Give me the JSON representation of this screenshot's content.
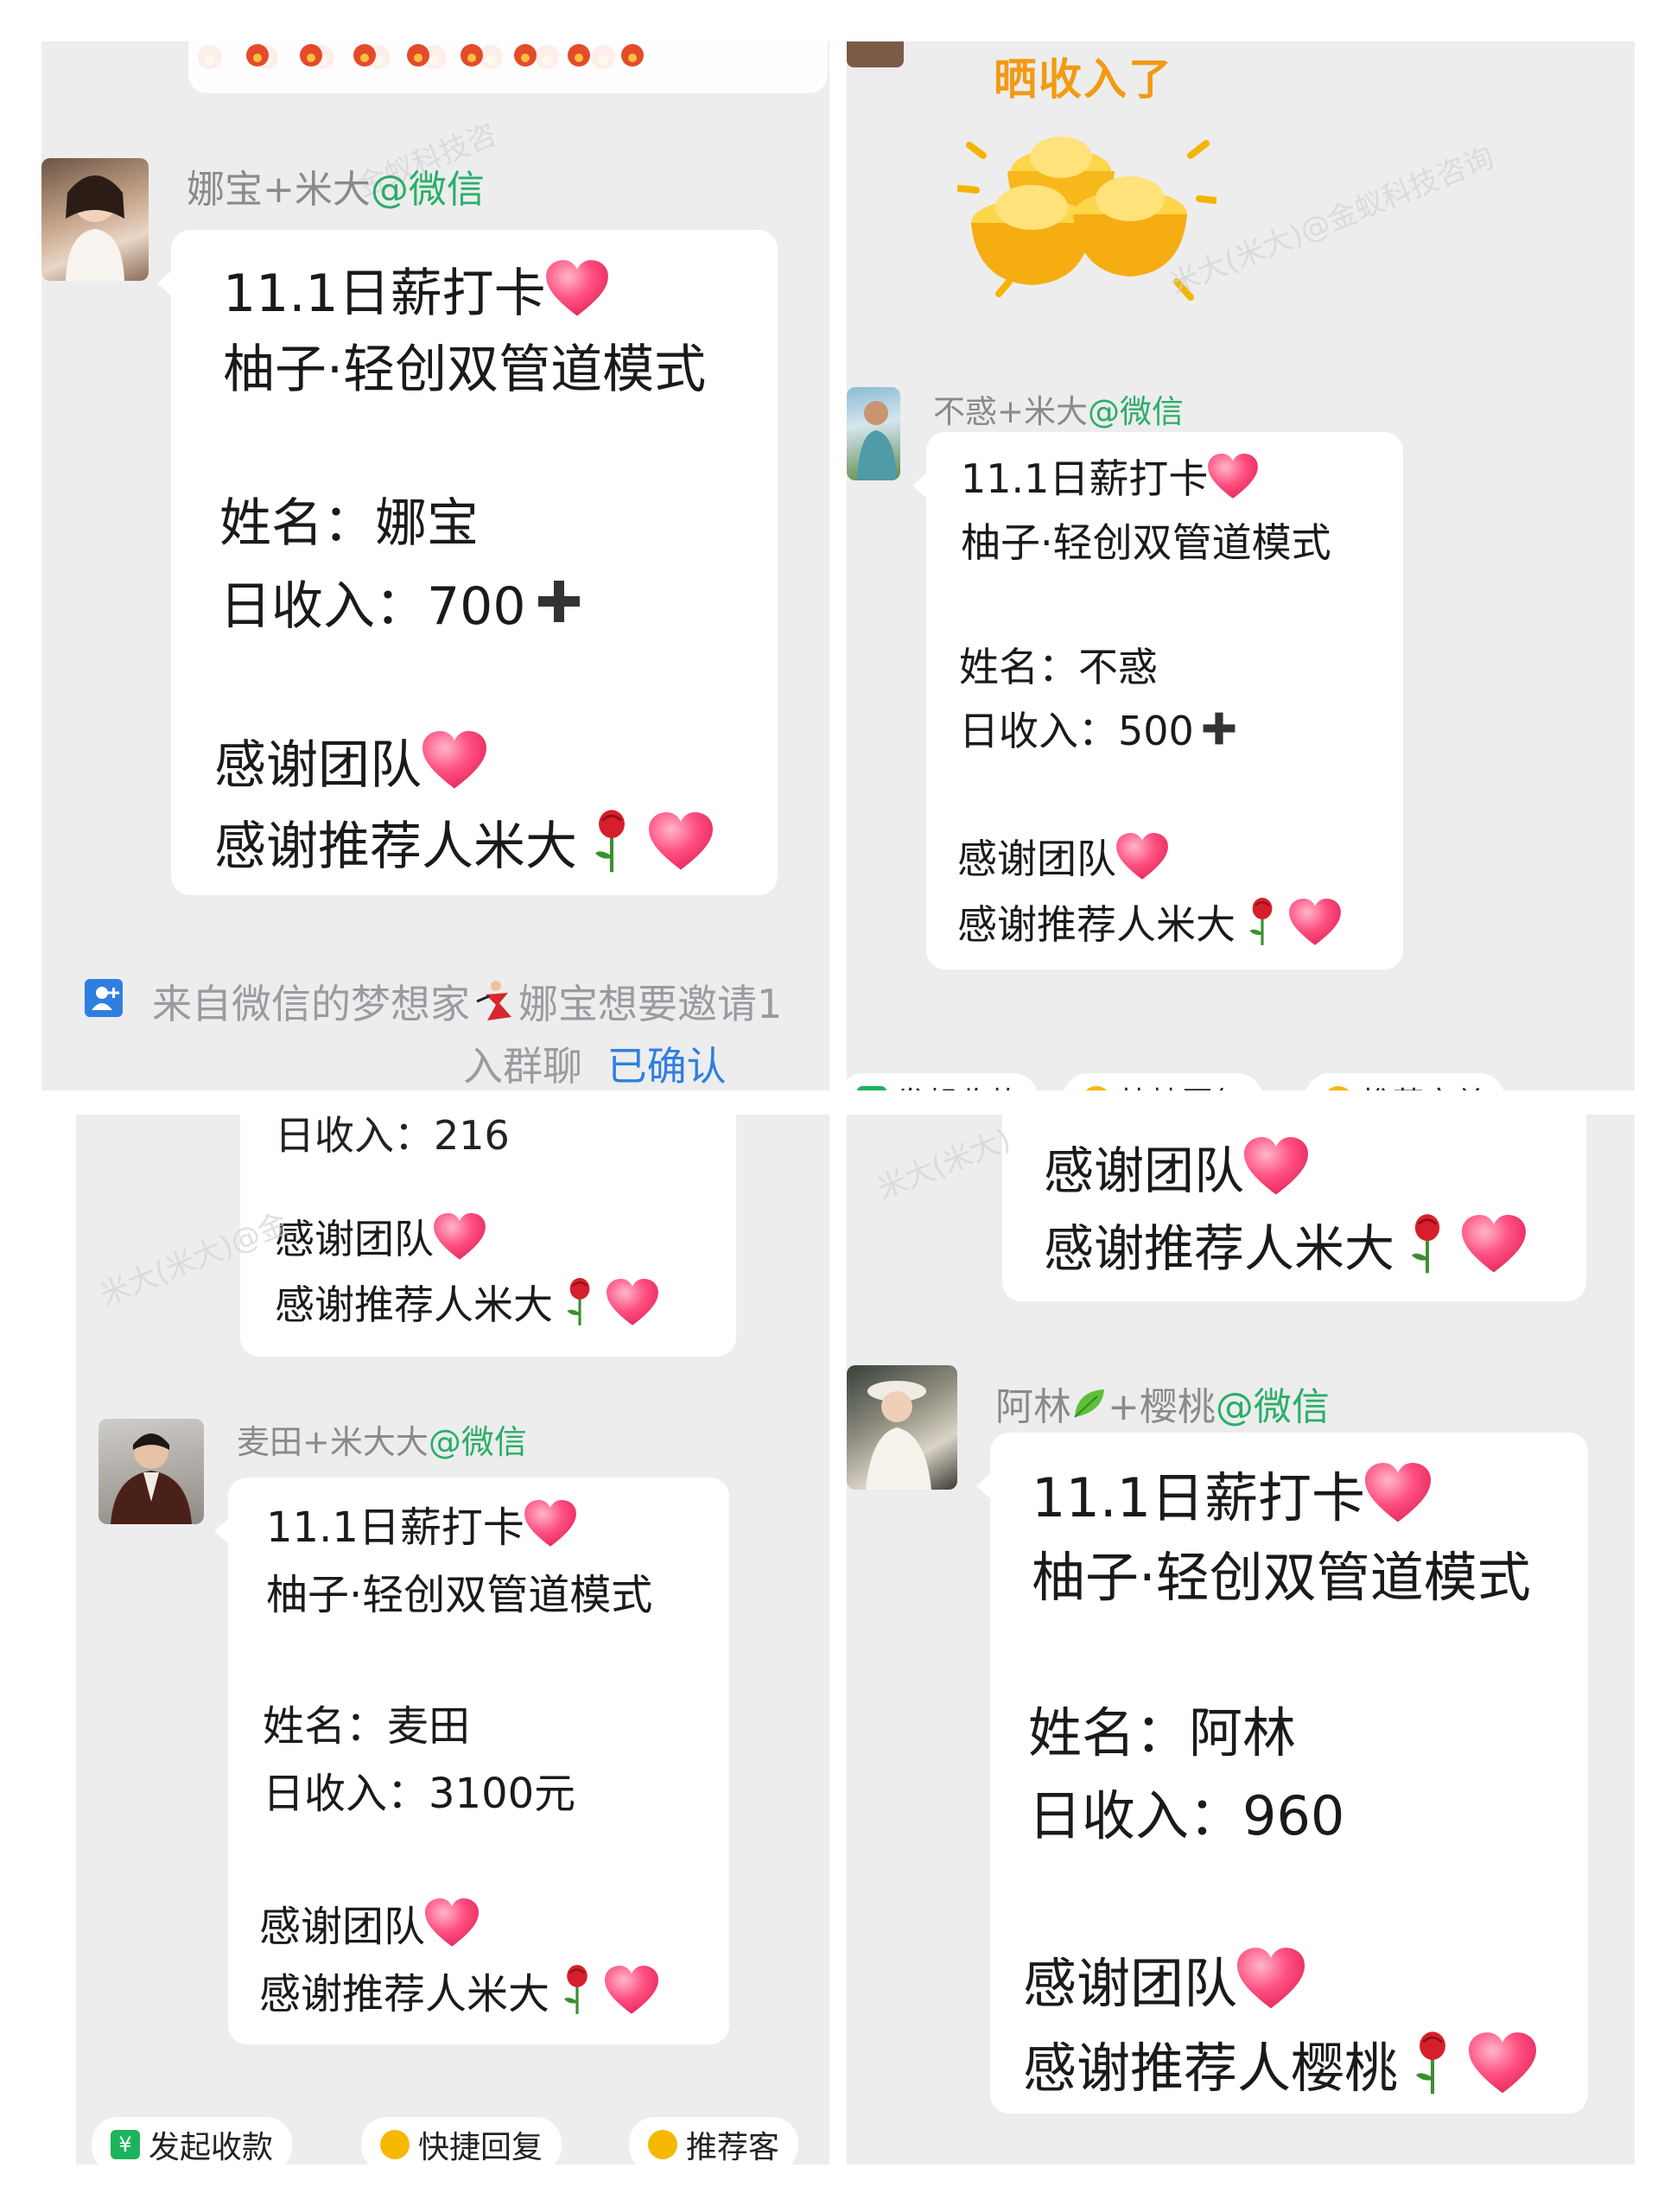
{
  "panel1": {
    "sender_name": "娜宝+米大",
    "sender_tag": "@微信",
    "lines": [
      "11.1日薪打卡",
      "柚子·轻创双管道模式",
      "姓名：娜宝",
      "日收入：700",
      "感谢团队",
      "感谢推荐人米大"
    ],
    "system_note_1": "来自微信的梦想家",
    "system_note_2": "娜宝想要邀请1",
    "system_note_3": "入群聊",
    "system_note_confirm": "已确认",
    "watermark": "金蚁科技咨"
  },
  "panel2": {
    "sticker_text": "晒收入了",
    "sender_name": "不惑+米大",
    "sender_tag": "@微信",
    "lines": [
      "11.1日薪打卡",
      "柚子·轻创双管道模式",
      "姓名：不惑",
      "日收入：500",
      "感谢团队",
      "感谢推荐人米大"
    ],
    "bottom_bar": [
      "发起收款",
      "快捷回复",
      "推荐定单"
    ],
    "watermark": "米大(米大)@金蚁科技咨询"
  },
  "panel3": {
    "top_partial": "日收入：216",
    "top_lines": [
      "感谢团队",
      "感谢推荐人米大"
    ],
    "sender_name": "麦田+米大大",
    "sender_tag": "@微信",
    "lines": [
      "11.1日薪打卡",
      "柚子·轻创双管道模式",
      "姓名：麦田",
      "日收入：3100元",
      "感谢团队",
      "感谢推荐人米大"
    ],
    "bottom_bar": [
      "发起收款",
      "快捷回复",
      "推荐客"
    ],
    "watermark": "米大(米大)@金"
  },
  "panel4": {
    "top_lines": [
      "感谢团队",
      "感谢推荐人米大"
    ],
    "sender_name_1": "阿林",
    "sender_name_2": "+樱桃",
    "sender_tag": "@微信",
    "lines": [
      "11.1日薪打卡",
      "柚子·轻创双管道模式",
      "姓名：阿林",
      "日收入：960",
      "感谢团队",
      "感谢推荐人樱桃"
    ],
    "watermark": "米大(米大)"
  },
  "colors": {
    "chat_bg": "#ededee",
    "bubble": "#ffffff",
    "wechat_green": "#2aae67",
    "link_blue": "#2f7fe0",
    "heart": "#ff4f80",
    "rose": "#e02525",
    "gold": "#f9b500"
  },
  "icons": [
    "heart-icon",
    "plus-icon",
    "rose-icon",
    "gold-ingot-icon",
    "flower-border-icon",
    "person-add-icon",
    "leaf-icon",
    "dancer-icon"
  ]
}
